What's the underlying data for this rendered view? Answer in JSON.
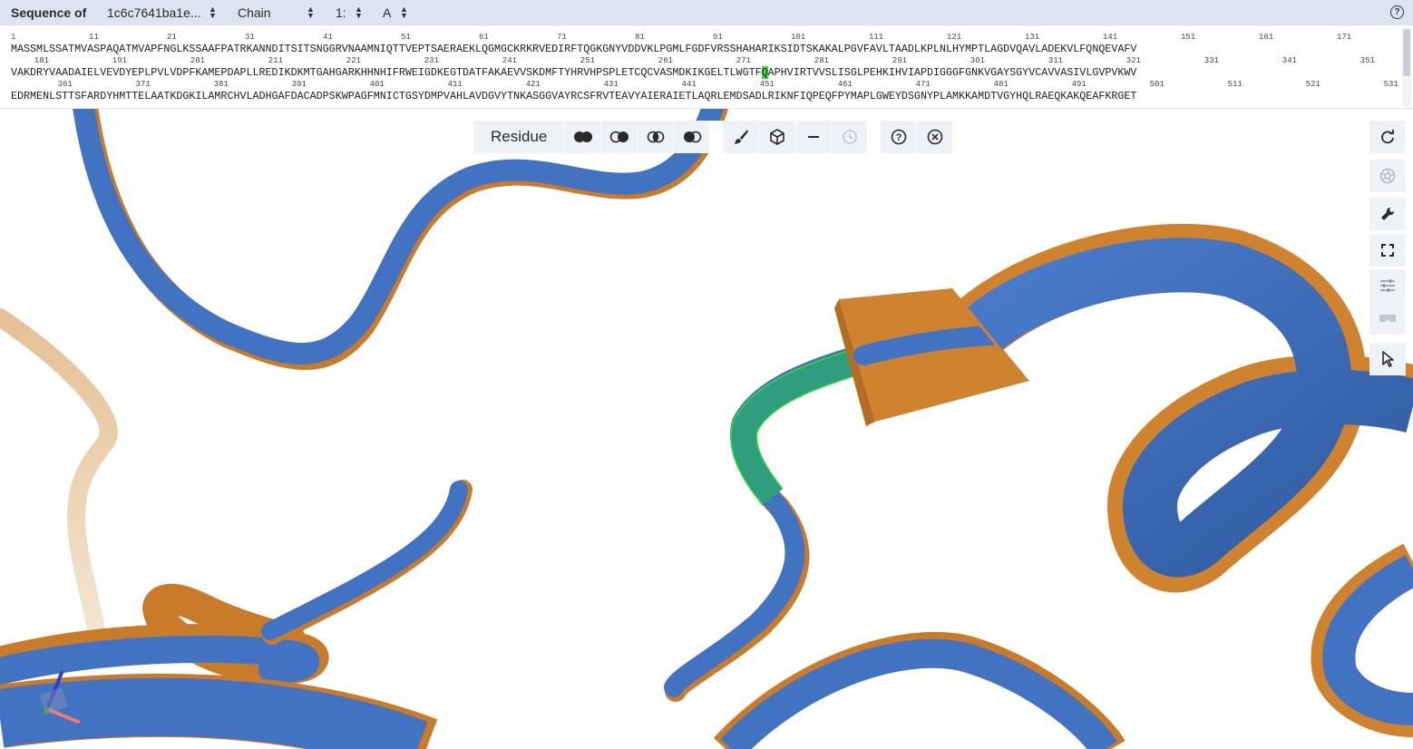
{
  "sequence_panel": {
    "title": "Sequence of",
    "entity_select": "1c6c7641ba1e...",
    "type_select": "Chain",
    "model_select": "1:",
    "chain_select": "A",
    "help_label": "?",
    "rows": [
      {
        "numbers": [
          {
            "text": "1",
            "pos": 0
          },
          {
            "text": "11",
            "pos": 10
          },
          {
            "text": "21",
            "pos": 20
          },
          {
            "text": "31",
            "pos": 30
          },
          {
            "text": "41",
            "pos": 40
          },
          {
            "text": "51",
            "pos": 50
          },
          {
            "text": "61",
            "pos": 60
          },
          {
            "text": "71",
            "pos": 70
          },
          {
            "text": "81",
            "pos": 80
          },
          {
            "text": "91",
            "pos": 90
          },
          {
            "text": "101",
            "pos": 100
          },
          {
            "text": "111",
            "pos": 110
          },
          {
            "text": "121",
            "pos": 120
          },
          {
            "text": "131",
            "pos": 130
          },
          {
            "text": "141",
            "pos": 140
          },
          {
            "text": "151",
            "pos": 150
          },
          {
            "text": "161",
            "pos": 160
          },
          {
            "text": "171",
            "pos": 170
          }
        ],
        "pre": "MASSMLSSATMVASPAQATMVAPFNGLKSSAAFPATRKANNDITSITSNGGRVNAAMNIQTTVEPTSAERAEKLQGMGCKRKRVEDIRFTQGKGNYVDDVKLPGMLFGDFVRSSHAHARIKSIDTSKAKALPGVFAVLTAADLKPLNLHYMPTLAGDVQAVLADEKVLFQNQEVAFV",
        "highlight": "",
        "post": ""
      },
      {
        "numbers": [
          {
            "text": "181",
            "pos": 3
          },
          {
            "text": "191",
            "pos": 13
          },
          {
            "text": "201",
            "pos": 23
          },
          {
            "text": "211",
            "pos": 33
          },
          {
            "text": "221",
            "pos": 43
          },
          {
            "text": "231",
            "pos": 53
          },
          {
            "text": "241",
            "pos": 63
          },
          {
            "text": "251",
            "pos": 73
          },
          {
            "text": "261",
            "pos": 83
          },
          {
            "text": "271",
            "pos": 93
          },
          {
            "text": "281",
            "pos": 103
          },
          {
            "text": "291",
            "pos": 113
          },
          {
            "text": "301",
            "pos": 123
          },
          {
            "text": "311",
            "pos": 133
          },
          {
            "text": "321",
            "pos": 143
          },
          {
            "text": "331",
            "pos": 153
          },
          {
            "text": "341",
            "pos": 163
          },
          {
            "text": "351",
            "pos": 173
          }
        ],
        "pre": "VAKDRYVAADAIELVEVDYEPLPVLVDPFKAMEPDAPLLREDIKDKMTGAHGARKHHNHIFRWEIGDKEGTDATFAKAEVVSKDMFTYHRVHPSPLETCQCVASMDKIKGELTLWGTF",
        "highlight": "Q",
        "post": "APHVIRTVVSLISGLPEHKIHVIAPDIGGGFGNKVGAYSGYVCAVVASIVLGVPVKWV"
      },
      {
        "numbers": [
          {
            "text": "361",
            "pos": 6
          },
          {
            "text": "371",
            "pos": 16
          },
          {
            "text": "381",
            "pos": 26
          },
          {
            "text": "391",
            "pos": 36
          },
          {
            "text": "401",
            "pos": 46
          },
          {
            "text": "411",
            "pos": 56
          },
          {
            "text": "421",
            "pos": 66
          },
          {
            "text": "431",
            "pos": 76
          },
          {
            "text": "441",
            "pos": 86
          },
          {
            "text": "451",
            "pos": 96
          },
          {
            "text": "461",
            "pos": 106
          },
          {
            "text": "471",
            "pos": 116
          },
          {
            "text": "481",
            "pos": 126
          },
          {
            "text": "491",
            "pos": 136
          },
          {
            "text": "501",
            "pos": 146
          },
          {
            "text": "511",
            "pos": 156
          },
          {
            "text": "521",
            "pos": 166
          },
          {
            "text": "531",
            "pos": 176
          }
        ],
        "pre": "EDRMENLSTTSFARDYHMTTELAATKDGKILAMRCHVLADHGAFDACADPSKWPAGFMNICTGSYDMPVAHLAVDGVYTNKASGGVAYRCSFRVTEAVYAIERAIETLAQRLEMDSADLRIKNFIQPEQFPYMAPLGWEYDSGNYPLAMKKAMDTVGYHQLRAEQKAKQEAFKRGET",
        "highlight": "",
        "post": ""
      }
    ]
  },
  "toolbar": {
    "mode_label": "Residue",
    "buttons": [
      {
        "name": "select-all-button",
        "icon": "two-filled-circles-icon"
      },
      {
        "name": "select-add-button",
        "icon": "circle-union-icon"
      },
      {
        "name": "select-intersect-button",
        "icon": "circle-intersect-icon"
      },
      {
        "name": "select-subtract-button",
        "icon": "circle-subtract-icon"
      },
      {
        "name": "color-button",
        "icon": "brush-icon"
      },
      {
        "name": "representation-button",
        "icon": "cube-icon"
      },
      {
        "name": "remove-button",
        "icon": "minus-icon"
      },
      {
        "name": "history-button",
        "icon": "history-icon"
      },
      {
        "name": "help-button",
        "icon": "help-circle-icon"
      },
      {
        "name": "close-button",
        "icon": "close-circle-icon"
      }
    ]
  },
  "right_controls": [
    {
      "name": "reset-camera-button",
      "icon": "refresh-icon"
    },
    {
      "name": "screenshot-button",
      "icon": "camera-aperture-icon"
    },
    {
      "name": "settings-button",
      "icon": "wrench-icon"
    },
    {
      "name": "fullscreen-button",
      "icon": "expand-icon"
    },
    {
      "name": "controls-button",
      "icon": "sliders-icon"
    },
    {
      "name": "vr-button",
      "icon": "vr-goggles-icon"
    },
    {
      "name": "selection-mode-button",
      "icon": "cursor-icon"
    }
  ],
  "colors": {
    "header_bg": "#dbe4f0",
    "ribbon_blue": "#4272c2",
    "ribbon_orange": "#d0832e",
    "selection_green": "#3bd83a",
    "selected_residue": "#2e9e7c"
  }
}
